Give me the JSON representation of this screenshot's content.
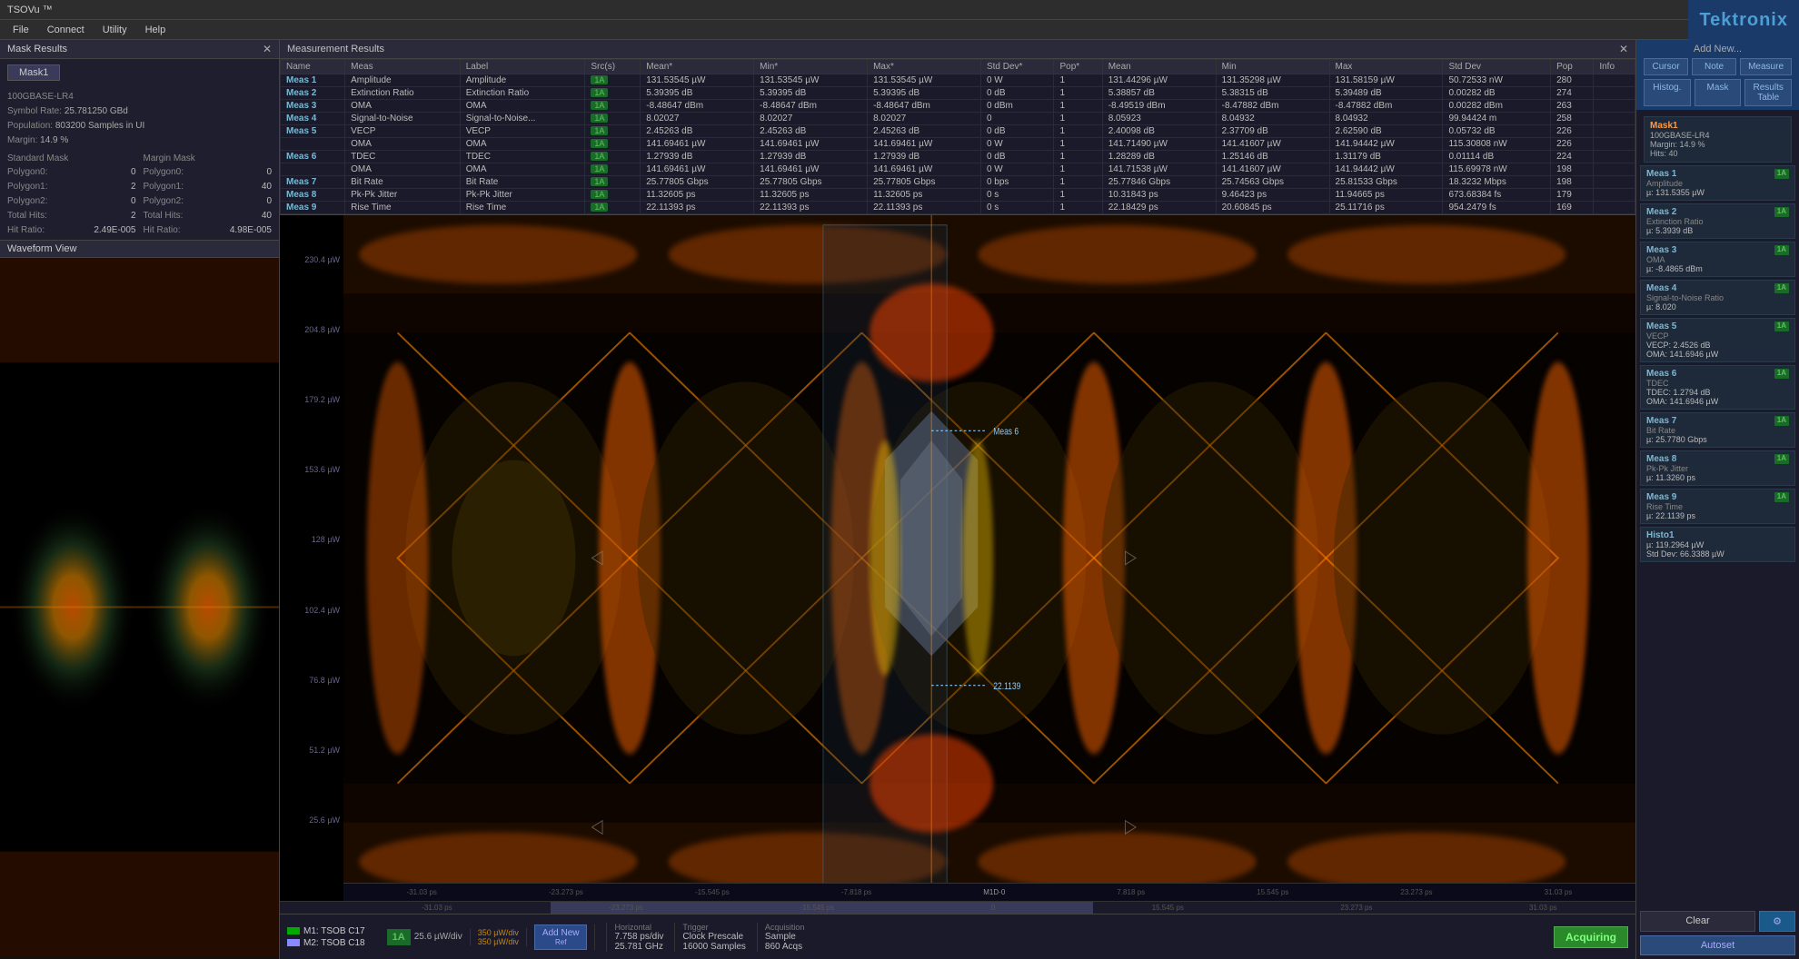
{
  "app": {
    "title": "TSOVu ™",
    "logo": "Tektronix"
  },
  "menu": {
    "items": [
      "File",
      "Connect",
      "Utility",
      "Help"
    ]
  },
  "mask_results": {
    "panel_title": "Mask Results",
    "tab_label": "Mask1",
    "standard": "100GBASE-LR4",
    "symbol_rate_label": "Symbol Rate:",
    "symbol_rate_val": "25.781250 GBd",
    "population_label": "Population:",
    "population_val": "803200 Samples in UI",
    "margin_label": "Margin:",
    "margin_val": "14.9 %",
    "standard_mask_label": "Standard Mask",
    "margin_mask_label": "Margin Mask",
    "polygon0_label": "Polygon0:",
    "polygon0_std": "0",
    "polygon0_margin": "0",
    "polygon1_label": "Polygon1:",
    "polygon1_std": "2",
    "polygon1_margin": "40",
    "polygon2_label": "Polygon2:",
    "polygon2_std": "0",
    "polygon2_margin": "0",
    "total_hits_label": "Total Hits:",
    "total_hits_std": "2",
    "total_hits_margin": "40",
    "hit_ratio_label": "Hit Ratio:",
    "hit_ratio_std": "2.49E-005",
    "hit_ratio_margin": "4.98E-005"
  },
  "measurement_results": {
    "panel_title": "Measurement Results",
    "columns": [
      "Name",
      "Meas",
      "Label",
      "Src(s)",
      "Mean*",
      "Min*",
      "Max*",
      "Std Dev*",
      "Pop*",
      "Mean",
      "Min",
      "Max",
      "Std Dev",
      "Pop",
      "Info"
    ],
    "rows": [
      {
        "name": "Meas 1",
        "meas": "Amplitude",
        "label": "Amplitude",
        "src": "1A",
        "mean_star": "131.53545 µW",
        "min_star": "131.53545 µW",
        "max_star": "131.53545 µW",
        "std_dev_star": "0 W",
        "pop_star": "1",
        "mean": "131.44296 µW",
        "min": "131.35298 µW",
        "max": "131.58159 µW",
        "std_dev": "50.72533 nW",
        "pop": "280",
        "info": ""
      },
      {
        "name": "Meas 2",
        "meas": "Extinction Ratio",
        "label": "Extinction Ratio",
        "src": "1A",
        "mean_star": "5.39395 dB",
        "min_star": "5.39395 dB",
        "max_star": "5.39395 dB",
        "std_dev_star": "0 dB",
        "pop_star": "1",
        "mean": "5.38857 dB",
        "min": "5.38315 dB",
        "max": "5.39489 dB",
        "std_dev": "0.00282 dB",
        "pop": "274",
        "info": ""
      },
      {
        "name": "Meas 3",
        "meas": "OMA",
        "label": "OMA",
        "src": "1A",
        "mean_star": "-8.48647 dBm",
        "min_star": "-8.48647 dBm",
        "max_star": "-8.48647 dBm",
        "std_dev_star": "0 dBm",
        "pop_star": "1",
        "mean": "-8.49519 dBm",
        "min": "-8.47882 dBm",
        "max": "-8.47882 dBm",
        "std_dev": "0.00282 dBm",
        "pop": "263",
        "info": ""
      },
      {
        "name": "Meas 4",
        "meas": "Signal-to-Noise",
        "label": "Signal-to-Noise...",
        "src": "1A",
        "mean_star": "8.02027",
        "min_star": "8.02027",
        "max_star": "8.02027",
        "std_dev_star": "0",
        "pop_star": "1",
        "mean": "8.05923",
        "min": "8.04932",
        "max": "8.04932",
        "std_dev": "99.94424 m",
        "pop": "258",
        "info": ""
      },
      {
        "name": "Meas 5",
        "meas": "VECP",
        "label": "VECP",
        "src": "1A",
        "mean_star": "2.45263 dB",
        "min_star": "2.45263 dB",
        "max_star": "2.45263 dB",
        "std_dev_star": "0 dB",
        "pop_star": "1",
        "mean": "2.40098 dB",
        "min": "2.37709 dB",
        "max": "2.62590 dB",
        "std_dev": "0.05732 dB",
        "pop": "226",
        "info": ""
      },
      {
        "name": "",
        "meas": "OMA",
        "label": "OMA",
        "src": "1A",
        "mean_star": "141.69461 µW",
        "min_star": "141.69461 µW",
        "max_star": "141.69461 µW",
        "std_dev_star": "0 W",
        "pop_star": "1",
        "mean": "141.71490 µW",
        "min": "141.41607 µW",
        "max": "141.94442 µW",
        "std_dev": "115.30808 nW",
        "pop": "226",
        "info": ""
      },
      {
        "name": "Meas 6",
        "meas": "TDEC",
        "label": "TDEC",
        "src": "1A",
        "mean_star": "1.27939 dB",
        "min_star": "1.27939 dB",
        "max_star": "1.27939 dB",
        "std_dev_star": "0 dB",
        "pop_star": "1",
        "mean": "1.28289 dB",
        "min": "1.25146 dB",
        "max": "1.31179 dB",
        "std_dev": "0.01114 dB",
        "pop": "224",
        "info": ""
      },
      {
        "name": "",
        "meas": "OMA",
        "label": "OMA",
        "src": "1A",
        "mean_star": "141.69461 µW",
        "min_star": "141.69461 µW",
        "max_star": "141.69461 µW",
        "std_dev_star": "0 W",
        "pop_star": "1",
        "mean": "141.71538 µW",
        "min": "141.41607 µW",
        "max": "141.94442 µW",
        "std_dev": "115.69978 nW",
        "pop": "198",
        "info": ""
      },
      {
        "name": "Meas 7",
        "meas": "Bit Rate",
        "label": "Bit Rate",
        "src": "1A",
        "mean_star": "25.77805 Gbps",
        "min_star": "25.77805 Gbps",
        "max_star": "25.77805 Gbps",
        "std_dev_star": "0 bps",
        "pop_star": "1",
        "mean": "25.77846 Gbps",
        "min": "25.74563 Gbps",
        "max": "25.81533 Gbps",
        "std_dev": "18.3232 Mbps",
        "pop": "198",
        "info": ""
      },
      {
        "name": "Meas 8",
        "meas": "Pk-Pk Jitter",
        "label": "Pk-Pk Jitter",
        "src": "1A",
        "mean_star": "11.32605 ps",
        "min_star": "11.32605 ps",
        "max_star": "11.32605 ps",
        "std_dev_star": "0 s",
        "pop_star": "1",
        "mean": "10.31843 ps",
        "min": "9.46423 ps",
        "max": "11.94665 ps",
        "std_dev": "673.68384 fs",
        "pop": "179",
        "info": ""
      },
      {
        "name": "Meas 9",
        "meas": "Rise Time",
        "label": "Rise Time",
        "src": "1A",
        "mean_star": "22.11393 ps",
        "min_star": "22.11393 ps",
        "max_star": "22.11393 ps",
        "std_dev_star": "0 s",
        "pop_star": "1",
        "mean": "22.18429 ps",
        "min": "20.60845 ps",
        "max": "25.11716 ps",
        "std_dev": "954.2479 fs",
        "pop": "169",
        "info": ""
      }
    ]
  },
  "waveform_view": {
    "label": "Waveform View"
  },
  "right_panel": {
    "add_new_label": "Add New...",
    "cursor_label": "Cursor",
    "note_label": "Note",
    "measure_label": "Measure",
    "histog_label": "Histog.",
    "mask_label": "Mask",
    "results_table_label": "Results Table",
    "mask_section": {
      "title": "Mask1",
      "standard": "100GBASE-LR4",
      "margin": "Margin: 14.9 %",
      "hits": "Hits: 40"
    },
    "measurements": [
      {
        "title": "Meas 1",
        "badge": "1A",
        "subtitle": "Amplitude",
        "value": "µ: 131.5355 µW"
      },
      {
        "title": "Meas 2",
        "badge": "1A",
        "subtitle": "Extinction Ratio",
        "value": "µ: 5.3939 dB"
      },
      {
        "title": "Meas 3",
        "badge": "1A",
        "subtitle": "OMA",
        "value": "µ: -8.4865 dBm"
      },
      {
        "title": "Meas 4",
        "badge": "1A",
        "subtitle": "Signal-to-Noise Ratio",
        "value": "µ: 8.020"
      },
      {
        "title": "Meas 5",
        "badge": "1A",
        "subtitle": "VECP",
        "value_line1": "VECP: 2.4526 dB",
        "value": "OMA: 141.6946 µW"
      },
      {
        "title": "Meas 6",
        "badge": "1A",
        "subtitle": "TDEC",
        "value_line1": "TDEC: 1.2794 dB",
        "value": "OMA: 141.6946 µW"
      },
      {
        "title": "Meas 7",
        "badge": "1A",
        "subtitle": "Bit Rate",
        "value": "µ: 25.7780 Gbps"
      },
      {
        "title": "Meas 8",
        "badge": "1A",
        "subtitle": "Pk-Pk Jitter",
        "value": "µ: 11.3260 ps"
      },
      {
        "title": "Meas 9",
        "badge": "1A",
        "subtitle": "Rise Time",
        "value": "µ: 22.1139 ps"
      },
      {
        "title": "Histo1",
        "subtitle": "",
        "value_line1": "µ: 119.2964 µW",
        "value": "Std Dev: 66.3388 µW"
      }
    ],
    "clear_label": "Clear",
    "autoset_label": "Autoset"
  },
  "bottom_bar": {
    "m1_label": "M1: TSOB C17",
    "m2_label": "M2: TSOB C18",
    "ch1a_label": "1A",
    "ch1a_val": "25.6 µW/div",
    "ch2_color": "#cc8800",
    "ch2_val1": "350 µW/div",
    "ch2_val2": "350 µW/div",
    "horizontal_label": "Horizontal",
    "horiz_val": "7.758 ps/div",
    "horiz_sub": "25.781 GHz",
    "trigger_label": "Trigger",
    "trigger_val": "Clock Prescale",
    "trigger_sub": "16000 Samples",
    "acquisition_label": "Acquisition",
    "acq_val": "Sample",
    "acq_sub": "860 Acqs",
    "add_new_label": "Add New",
    "ref_label": "Ref",
    "acquiring_label": "Acquiring"
  },
  "timeline": {
    "ticks": [
      "-31.03 ps",
      "-23.273 ps",
      "-15.545 ps",
      "-7.818 ps",
      "0",
      "7.818 ps",
      "15.545 ps",
      "23.273 ps",
      "31.03 ps"
    ],
    "bottom_ticks": [
      "-31.03 ps",
      "-23.273 ps",
      "-15.545 ps",
      "0",
      "15.545 ps",
      "23.273 ps",
      "31.03 ps"
    ]
  },
  "y_labels": [
    "230.4 µW",
    "204.8 µW",
    "179.2 µW",
    "153.6 µW",
    "128 µW",
    "102.4 µW",
    "76.8 µW",
    "51.2 µW",
    "25.6 µW"
  ],
  "meas_6": {
    "label": "Meas 6"
  },
  "meas_22": {
    "label": "Meas 22.1139"
  },
  "clear_btn": {
    "label": "Clear"
  },
  "measure_btn": {
    "label": "Measure"
  },
  "cursor_btn": {
    "label": "Cursor"
  }
}
